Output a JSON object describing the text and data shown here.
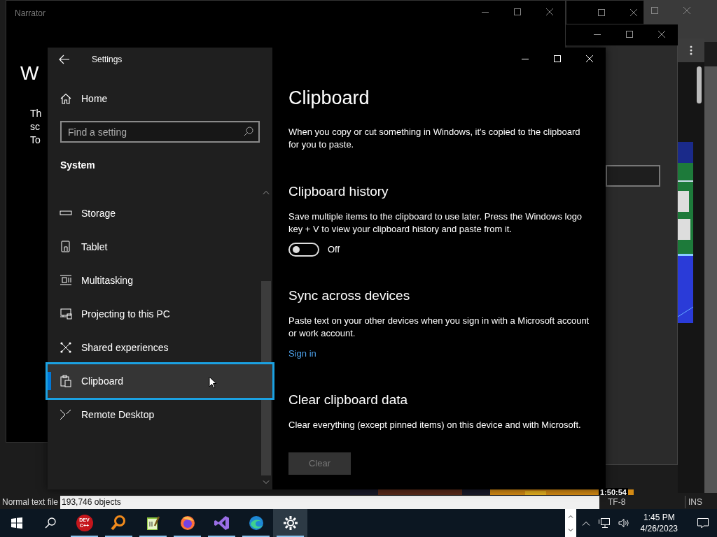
{
  "background": {
    "narrator": {
      "title": "Narrator",
      "heading": "W",
      "lines": [
        "Th",
        "sc",
        "To"
      ]
    }
  },
  "settings": {
    "title": "Settings",
    "home": "Home",
    "search": {
      "placeholder": "Find a setting"
    },
    "group": "System",
    "nav": [
      {
        "kind": "storage",
        "label": "Storage",
        "selected": false
      },
      {
        "kind": "tablet",
        "label": "Tablet",
        "selected": false
      },
      {
        "kind": "multitasking",
        "label": "Multitasking",
        "selected": false
      },
      {
        "kind": "projecting",
        "label": "Projecting to this PC",
        "selected": false
      },
      {
        "kind": "shared",
        "label": "Shared experiences",
        "selected": false
      },
      {
        "kind": "clipboard",
        "label": "Clipboard",
        "selected": true
      },
      {
        "kind": "remote",
        "label": "Remote Desktop",
        "selected": false
      }
    ],
    "page": {
      "title": "Clipboard",
      "intro": "When you copy or cut something in Windows, it's copied to the clipboard for you to paste.",
      "sections": [
        {
          "heading": "Clipboard history",
          "text": "Save multiple items to the clipboard to use later. Press the Windows logo key + V to view your clipboard history and paste from it.",
          "control": {
            "kind": "toggle",
            "on": false,
            "label": "Off"
          }
        },
        {
          "heading": "Sync across devices",
          "text": "Paste text on your other devices when you sign in with a Microsoft account or work account.",
          "control": {
            "kind": "link",
            "label": "Sign in"
          }
        },
        {
          "heading": "Clear clipboard data",
          "text": "Clear everything (except pinned items) on this device and with Microsoft.",
          "control": {
            "kind": "button",
            "label": "Clear",
            "disabled": true
          }
        }
      ]
    }
  },
  "status_bar": {
    "file_type": "Normal text file",
    "objects": "193,746 objects",
    "encoding": "TF-8",
    "mode": "INS",
    "video_time": "1:50:54"
  },
  "taskbar": {
    "apps": [
      {
        "kind": "devcpp",
        "label_lines": [
          "DEV",
          "C++"
        ],
        "selected": false
      },
      {
        "kind": "magnifier",
        "selected": false
      },
      {
        "kind": "notepad",
        "selected": false
      },
      {
        "kind": "firefox",
        "selected": false
      },
      {
        "kind": "vs",
        "selected": false
      },
      {
        "kind": "edge",
        "selected": false
      },
      {
        "kind": "settings",
        "selected": true
      }
    ],
    "time": "1:45 PM",
    "date": "4/26/2023"
  }
}
